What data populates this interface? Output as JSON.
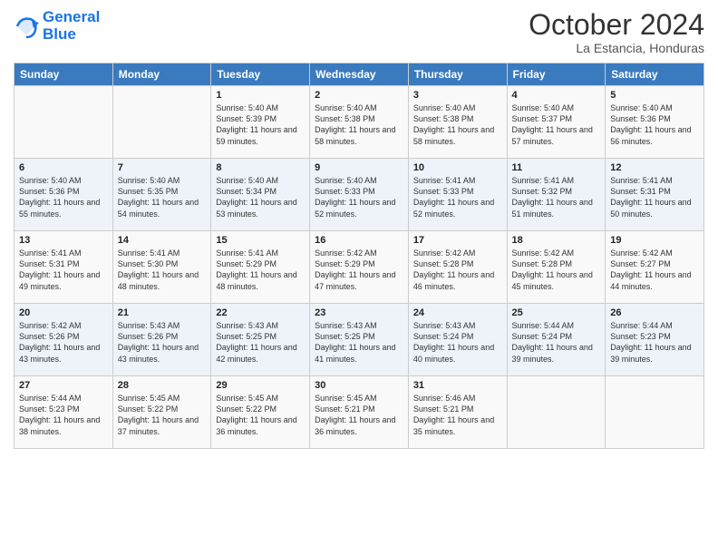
{
  "header": {
    "logo_line1": "General",
    "logo_line2": "Blue",
    "month_title": "October 2024",
    "location": "La Estancia, Honduras"
  },
  "days_of_week": [
    "Sunday",
    "Monday",
    "Tuesday",
    "Wednesday",
    "Thursday",
    "Friday",
    "Saturday"
  ],
  "weeks": [
    [
      {
        "day": "",
        "info": ""
      },
      {
        "day": "",
        "info": ""
      },
      {
        "day": "1",
        "info": "Sunrise: 5:40 AM\nSunset: 5:39 PM\nDaylight: 11 hours and 59 minutes."
      },
      {
        "day": "2",
        "info": "Sunrise: 5:40 AM\nSunset: 5:38 PM\nDaylight: 11 hours and 58 minutes."
      },
      {
        "day": "3",
        "info": "Sunrise: 5:40 AM\nSunset: 5:38 PM\nDaylight: 11 hours and 58 minutes."
      },
      {
        "day": "4",
        "info": "Sunrise: 5:40 AM\nSunset: 5:37 PM\nDaylight: 11 hours and 57 minutes."
      },
      {
        "day": "5",
        "info": "Sunrise: 5:40 AM\nSunset: 5:36 PM\nDaylight: 11 hours and 56 minutes."
      }
    ],
    [
      {
        "day": "6",
        "info": "Sunrise: 5:40 AM\nSunset: 5:36 PM\nDaylight: 11 hours and 55 minutes."
      },
      {
        "day": "7",
        "info": "Sunrise: 5:40 AM\nSunset: 5:35 PM\nDaylight: 11 hours and 54 minutes."
      },
      {
        "day": "8",
        "info": "Sunrise: 5:40 AM\nSunset: 5:34 PM\nDaylight: 11 hours and 53 minutes."
      },
      {
        "day": "9",
        "info": "Sunrise: 5:40 AM\nSunset: 5:33 PM\nDaylight: 11 hours and 52 minutes."
      },
      {
        "day": "10",
        "info": "Sunrise: 5:41 AM\nSunset: 5:33 PM\nDaylight: 11 hours and 52 minutes."
      },
      {
        "day": "11",
        "info": "Sunrise: 5:41 AM\nSunset: 5:32 PM\nDaylight: 11 hours and 51 minutes."
      },
      {
        "day": "12",
        "info": "Sunrise: 5:41 AM\nSunset: 5:31 PM\nDaylight: 11 hours and 50 minutes."
      }
    ],
    [
      {
        "day": "13",
        "info": "Sunrise: 5:41 AM\nSunset: 5:31 PM\nDaylight: 11 hours and 49 minutes."
      },
      {
        "day": "14",
        "info": "Sunrise: 5:41 AM\nSunset: 5:30 PM\nDaylight: 11 hours and 48 minutes."
      },
      {
        "day": "15",
        "info": "Sunrise: 5:41 AM\nSunset: 5:29 PM\nDaylight: 11 hours and 48 minutes."
      },
      {
        "day": "16",
        "info": "Sunrise: 5:42 AM\nSunset: 5:29 PM\nDaylight: 11 hours and 47 minutes."
      },
      {
        "day": "17",
        "info": "Sunrise: 5:42 AM\nSunset: 5:28 PM\nDaylight: 11 hours and 46 minutes."
      },
      {
        "day": "18",
        "info": "Sunrise: 5:42 AM\nSunset: 5:28 PM\nDaylight: 11 hours and 45 minutes."
      },
      {
        "day": "19",
        "info": "Sunrise: 5:42 AM\nSunset: 5:27 PM\nDaylight: 11 hours and 44 minutes."
      }
    ],
    [
      {
        "day": "20",
        "info": "Sunrise: 5:42 AM\nSunset: 5:26 PM\nDaylight: 11 hours and 43 minutes."
      },
      {
        "day": "21",
        "info": "Sunrise: 5:43 AM\nSunset: 5:26 PM\nDaylight: 11 hours and 43 minutes."
      },
      {
        "day": "22",
        "info": "Sunrise: 5:43 AM\nSunset: 5:25 PM\nDaylight: 11 hours and 42 minutes."
      },
      {
        "day": "23",
        "info": "Sunrise: 5:43 AM\nSunset: 5:25 PM\nDaylight: 11 hours and 41 minutes."
      },
      {
        "day": "24",
        "info": "Sunrise: 5:43 AM\nSunset: 5:24 PM\nDaylight: 11 hours and 40 minutes."
      },
      {
        "day": "25",
        "info": "Sunrise: 5:44 AM\nSunset: 5:24 PM\nDaylight: 11 hours and 39 minutes."
      },
      {
        "day": "26",
        "info": "Sunrise: 5:44 AM\nSunset: 5:23 PM\nDaylight: 11 hours and 39 minutes."
      }
    ],
    [
      {
        "day": "27",
        "info": "Sunrise: 5:44 AM\nSunset: 5:23 PM\nDaylight: 11 hours and 38 minutes."
      },
      {
        "day": "28",
        "info": "Sunrise: 5:45 AM\nSunset: 5:22 PM\nDaylight: 11 hours and 37 minutes."
      },
      {
        "day": "29",
        "info": "Sunrise: 5:45 AM\nSunset: 5:22 PM\nDaylight: 11 hours and 36 minutes."
      },
      {
        "day": "30",
        "info": "Sunrise: 5:45 AM\nSunset: 5:21 PM\nDaylight: 11 hours and 36 minutes."
      },
      {
        "day": "31",
        "info": "Sunrise: 5:46 AM\nSunset: 5:21 PM\nDaylight: 11 hours and 35 minutes."
      },
      {
        "day": "",
        "info": ""
      },
      {
        "day": "",
        "info": ""
      }
    ]
  ]
}
